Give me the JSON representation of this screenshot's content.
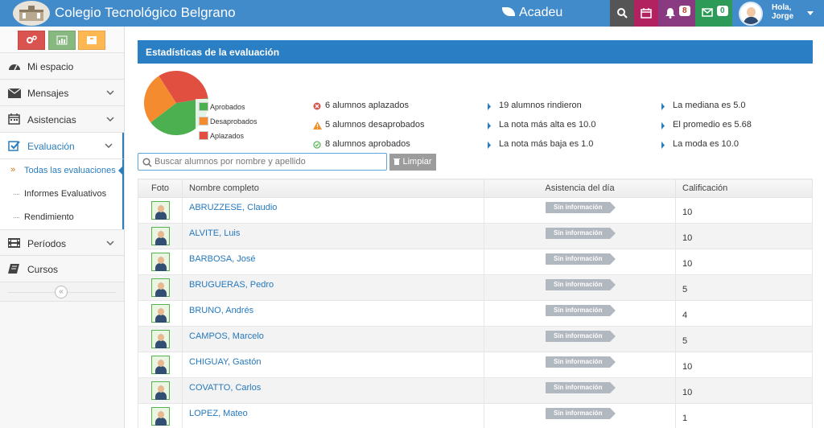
{
  "header": {
    "school_name": "Colegio Tecnológico Belgrano",
    "brand": "Acadeu",
    "notifications_count": "8",
    "messages_count": "0",
    "greeting": "Hola,",
    "user_name": "Jorge",
    "colors": {
      "bar": "#428bca",
      "search": "#555555",
      "calendar": "#b22160",
      "notifications": "#8a3a80",
      "messages": "#2d9a58"
    }
  },
  "sidebar": {
    "items": [
      {
        "label": "Mi espacio",
        "icon": "dashboard-icon"
      },
      {
        "label": "Mensajes",
        "icon": "envelope-icon"
      },
      {
        "label": "Asistencias",
        "icon": "calendar-icon"
      },
      {
        "label": "Evaluación",
        "icon": "check-square-icon"
      },
      {
        "label": "Períodos",
        "icon": "film-icon"
      },
      {
        "label": "Cursos",
        "icon": "book-icon"
      }
    ],
    "sub_items": [
      {
        "label": "Todas las evaluaciones"
      },
      {
        "label": "Informes Evaluativos"
      },
      {
        "label": "Rendimiento"
      }
    ],
    "collapse": "«"
  },
  "stats": {
    "title": "Estadísticas de la evaluación",
    "legend": [
      "Aprobados",
      "Desaprobados",
      "Aplazados"
    ],
    "col1": [
      "6 alumnos aplazados",
      "5 alumnos desaprobados",
      "8 alumnos aprobados"
    ],
    "col2": [
      "19 alumnos rindieron",
      "La nota más alta es 10.0",
      "La nota más baja es 1.0"
    ],
    "col3": [
      "La mediana es 5.0",
      "El promedio es 5.68",
      "La moda es 10.0"
    ]
  },
  "chart_data": {
    "type": "pie",
    "categories": [
      "Aprobados",
      "Desaprobados",
      "Aplazados"
    ],
    "values": [
      8,
      5,
      6
    ],
    "colors": [
      "#4caf50",
      "#f48b2e",
      "#e04f3f"
    ]
  },
  "search": {
    "placeholder": "Buscar alumnos por nombre y apellido",
    "clear_label": "Limpiar"
  },
  "table": {
    "headers": [
      "Foto",
      "Nombre completo",
      "Asistencia del día",
      "Calificación"
    ],
    "rows": [
      {
        "name": "ABRUZZESE, Claudio",
        "attendance": "Sin información",
        "grade": "10"
      },
      {
        "name": "ALVITE, Luis",
        "attendance": "Sin información",
        "grade": "10"
      },
      {
        "name": "BARBOSA, José",
        "attendance": "Sin información",
        "grade": "10"
      },
      {
        "name": "BRUGUERAS, Pedro",
        "attendance": "Sin información",
        "grade": "5"
      },
      {
        "name": "BRUNO, Andrés",
        "attendance": "Sin información",
        "grade": "4"
      },
      {
        "name": "CAMPOS, Marcelo",
        "attendance": "Sin información",
        "grade": "5"
      },
      {
        "name": "CHIGUAY, Gastón",
        "attendance": "Sin información",
        "grade": "10"
      },
      {
        "name": "COVATTO, Carlos",
        "attendance": "Sin información",
        "grade": "10"
      },
      {
        "name": "LOPEZ, Mateo",
        "attendance": "Sin información",
        "grade": "1"
      }
    ]
  }
}
